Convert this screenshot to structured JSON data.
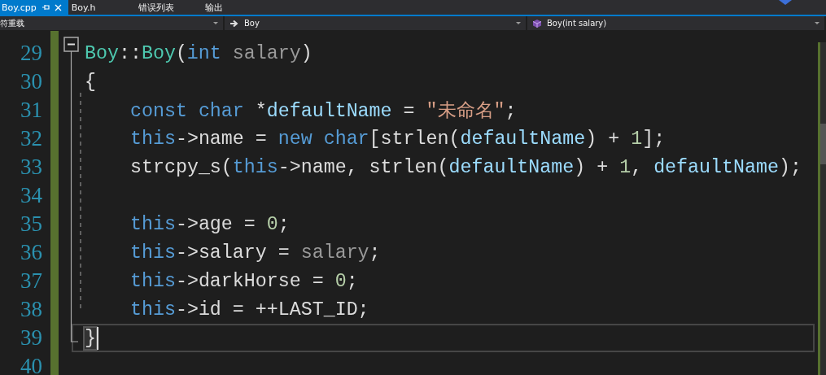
{
  "tabs": [
    {
      "label": "Boy.cpp",
      "selected": true,
      "pinned": true,
      "closable": true
    },
    {
      "label": "Boy.h",
      "selected": false,
      "pinned": false,
      "closable": false
    },
    {
      "label": "错误列表",
      "selected": false,
      "pinned": false,
      "closable": false
    },
    {
      "label": "输出",
      "selected": false,
      "pinned": false,
      "closable": false
    }
  ],
  "navigation": [
    {
      "kind": "plain",
      "value": "符重载"
    },
    {
      "kind": "class",
      "value": "Boy"
    },
    {
      "kind": "method",
      "value": "Boy(int salary)"
    }
  ],
  "lines": [
    {
      "number": "29",
      "current": false,
      "indented": false,
      "tokens": [
        {
          "text": "Boy",
          "kind": "type"
        },
        {
          "text": "::",
          "kind": "plain"
        },
        {
          "text": "Boy",
          "kind": "type"
        },
        {
          "text": "(",
          "kind": "plain"
        },
        {
          "text": "int",
          "kind": "kw"
        },
        {
          "text": " salary",
          "kind": "param"
        },
        {
          "text": ")",
          "kind": "plain"
        }
      ]
    },
    {
      "number": "30",
      "current": false,
      "indented": false,
      "tokens": [
        {
          "text": "{",
          "kind": "plain"
        }
      ]
    },
    {
      "number": "31",
      "current": false,
      "indented": true,
      "tokens": [
        {
          "text": "const",
          "kind": "kw"
        },
        {
          "text": " char",
          "kind": "kw"
        },
        {
          "text": " *",
          "kind": "plain"
        },
        {
          "text": "defaultName",
          "kind": "local"
        },
        {
          "text": " = ",
          "kind": "plain"
        },
        {
          "text": "\"未命名\"",
          "kind": "str"
        },
        {
          "text": ";",
          "kind": "plain"
        }
      ]
    },
    {
      "number": "32",
      "current": false,
      "indented": true,
      "tokens": [
        {
          "text": "this",
          "kind": "kw"
        },
        {
          "text": "->name = ",
          "kind": "plain"
        },
        {
          "text": "new",
          "kind": "kw"
        },
        {
          "text": " char",
          "kind": "kw"
        },
        {
          "text": "[strlen(",
          "kind": "plain"
        },
        {
          "text": "defaultName",
          "kind": "local"
        },
        {
          "text": ") + ",
          "kind": "plain"
        },
        {
          "text": "1",
          "kind": "num"
        },
        {
          "text": "];",
          "kind": "plain"
        }
      ]
    },
    {
      "number": "33",
      "current": false,
      "indented": true,
      "tokens": [
        {
          "text": "strcpy_s(",
          "kind": "plain"
        },
        {
          "text": "this",
          "kind": "kw"
        },
        {
          "text": "->name, strlen(",
          "kind": "plain"
        },
        {
          "text": "defaultName",
          "kind": "local"
        },
        {
          "text": ") + ",
          "kind": "plain"
        },
        {
          "text": "1",
          "kind": "num"
        },
        {
          "text": ", ",
          "kind": "plain"
        },
        {
          "text": "defaultName",
          "kind": "local"
        },
        {
          "text": ");",
          "kind": "plain"
        }
      ]
    },
    {
      "number": "34",
      "current": false
    },
    {
      "number": "35",
      "current": false,
      "indented": true,
      "tokens": [
        {
          "text": "this",
          "kind": "kw"
        },
        {
          "text": "->age = ",
          "kind": "plain"
        },
        {
          "text": "0",
          "kind": "num"
        },
        {
          "text": ";",
          "kind": "plain"
        }
      ]
    },
    {
      "number": "36",
      "current": false,
      "indented": true,
      "tokens": [
        {
          "text": "this",
          "kind": "kw"
        },
        {
          "text": "->salary = ",
          "kind": "plain"
        },
        {
          "text": "salary",
          "kind": "param"
        },
        {
          "text": ";",
          "kind": "plain"
        }
      ]
    },
    {
      "number": "37",
      "current": false,
      "indented": true,
      "tokens": [
        {
          "text": "this",
          "kind": "kw"
        },
        {
          "text": "->darkHorse = ",
          "kind": "plain"
        },
        {
          "text": "0",
          "kind": "num"
        },
        {
          "text": ";",
          "kind": "plain"
        }
      ]
    },
    {
      "number": "38",
      "current": false,
      "indented": true,
      "tokens": [
        {
          "text": "this",
          "kind": "kw"
        },
        {
          "text": "->id = ++LAST_ID;",
          "kind": "plain"
        }
      ]
    },
    {
      "number": "39",
      "current": true,
      "indented": false,
      "tokens": [
        {
          "text": "}",
          "kind": "match"
        }
      ]
    },
    {
      "number": "40",
      "current": false
    }
  ]
}
